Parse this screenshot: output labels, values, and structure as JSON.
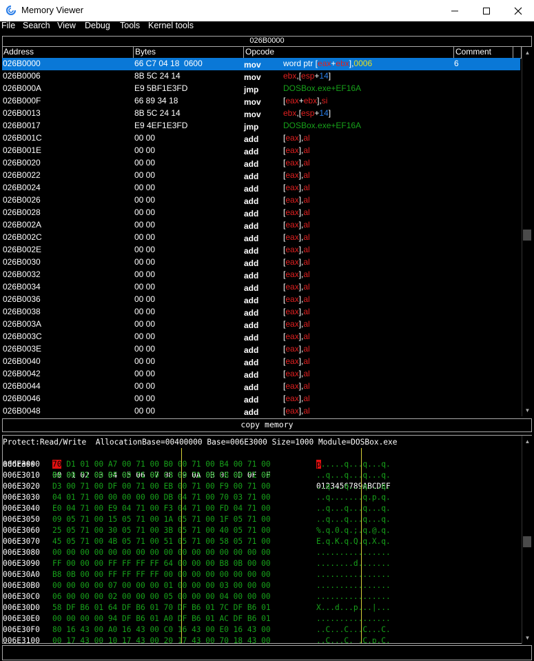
{
  "window": {
    "title": "Memory Viewer",
    "minimize_icon": "minimize-icon",
    "maximize_icon": "maximize-icon",
    "close_icon": "close-icon"
  },
  "menu": [
    "File",
    "Search",
    "View",
    "Debug",
    "Tools",
    "Kernel tools"
  ],
  "disassembler": {
    "header": "026B0000",
    "columns": [
      "Address",
      "Bytes",
      "Opcode",
      "Comment"
    ],
    "rows": [
      {
        "addr": "026B0000",
        "bytes": "66 C7 04 18  0600",
        "op": "mov",
        "args": [
          [
            "word ptr [",
            "w"
          ],
          [
            "eax",
            "r"
          ],
          [
            "+",
            "w"
          ],
          [
            "ebx",
            "r"
          ],
          [
            "],",
            "w"
          ],
          [
            "0006",
            "y"
          ]
        ],
        "comment": "6",
        "selected": true
      },
      {
        "addr": "026B0006",
        "bytes": "8B 5C 24 14",
        "op": "mov",
        "args": [
          [
            "ebx",
            "r"
          ],
          [
            ",[",
            "w"
          ],
          [
            "esp",
            "r"
          ],
          [
            "+",
            "w"
          ],
          [
            "14",
            "b"
          ],
          [
            "]",
            "w"
          ]
        ],
        "comment": ""
      },
      {
        "addr": "026B000A",
        "bytes": "E9 5BF1E3FD",
        "op": "jmp",
        "args": [
          [
            "DOSBox.exe+EF16A",
            "g"
          ]
        ],
        "comment": ""
      },
      {
        "addr": "026B000F",
        "bytes": "66 89 34 18",
        "op": "mov",
        "args": [
          [
            "[",
            "w"
          ],
          [
            "eax",
            "r"
          ],
          [
            "+",
            "w"
          ],
          [
            "ebx",
            "r"
          ],
          [
            "],",
            "w"
          ],
          [
            "si",
            "r"
          ]
        ],
        "comment": ""
      },
      {
        "addr": "026B0013",
        "bytes": "8B 5C 24 14",
        "op": "mov",
        "args": [
          [
            "ebx",
            "r"
          ],
          [
            ",[",
            "w"
          ],
          [
            "esp",
            "r"
          ],
          [
            "+",
            "w"
          ],
          [
            "14",
            "b"
          ],
          [
            "]",
            "w"
          ]
        ],
        "comment": ""
      },
      {
        "addr": "026B0017",
        "bytes": "E9 4EF1E3FD",
        "op": "jmp",
        "args": [
          [
            "DOSBox.exe+EF16A",
            "g"
          ]
        ],
        "comment": ""
      },
      {
        "addr": "026B001C",
        "bytes": "00 00",
        "op": "add",
        "args": [
          [
            "[",
            "w"
          ],
          [
            "eax",
            "r"
          ],
          [
            "],",
            "w"
          ],
          [
            "al",
            "r"
          ]
        ],
        "comment": ""
      },
      {
        "addr": "026B001E",
        "bytes": "00 00",
        "op": "add",
        "args": [
          [
            "[",
            "w"
          ],
          [
            "eax",
            "r"
          ],
          [
            "],",
            "w"
          ],
          [
            "al",
            "r"
          ]
        ],
        "comment": ""
      },
      {
        "addr": "026B0020",
        "bytes": "00 00",
        "op": "add",
        "args": [
          [
            "[",
            "w"
          ],
          [
            "eax",
            "r"
          ],
          [
            "],",
            "w"
          ],
          [
            "al",
            "r"
          ]
        ],
        "comment": ""
      },
      {
        "addr": "026B0022",
        "bytes": "00 00",
        "op": "add",
        "args": [
          [
            "[",
            "w"
          ],
          [
            "eax",
            "r"
          ],
          [
            "],",
            "w"
          ],
          [
            "al",
            "r"
          ]
        ],
        "comment": ""
      },
      {
        "addr": "026B0024",
        "bytes": "00 00",
        "op": "add",
        "args": [
          [
            "[",
            "w"
          ],
          [
            "eax",
            "r"
          ],
          [
            "],",
            "w"
          ],
          [
            "al",
            "r"
          ]
        ],
        "comment": ""
      },
      {
        "addr": "026B0026",
        "bytes": "00 00",
        "op": "add",
        "args": [
          [
            "[",
            "w"
          ],
          [
            "eax",
            "r"
          ],
          [
            "],",
            "w"
          ],
          [
            "al",
            "r"
          ]
        ],
        "comment": ""
      },
      {
        "addr": "026B0028",
        "bytes": "00 00",
        "op": "add",
        "args": [
          [
            "[",
            "w"
          ],
          [
            "eax",
            "r"
          ],
          [
            "],",
            "w"
          ],
          [
            "al",
            "r"
          ]
        ],
        "comment": ""
      },
      {
        "addr": "026B002A",
        "bytes": "00 00",
        "op": "add",
        "args": [
          [
            "[",
            "w"
          ],
          [
            "eax",
            "r"
          ],
          [
            "],",
            "w"
          ],
          [
            "al",
            "r"
          ]
        ],
        "comment": ""
      },
      {
        "addr": "026B002C",
        "bytes": "00 00",
        "op": "add",
        "args": [
          [
            "[",
            "w"
          ],
          [
            "eax",
            "r"
          ],
          [
            "],",
            "w"
          ],
          [
            "al",
            "r"
          ]
        ],
        "comment": ""
      },
      {
        "addr": "026B002E",
        "bytes": "00 00",
        "op": "add",
        "args": [
          [
            "[",
            "w"
          ],
          [
            "eax",
            "r"
          ],
          [
            "],",
            "w"
          ],
          [
            "al",
            "r"
          ]
        ],
        "comment": ""
      },
      {
        "addr": "026B0030",
        "bytes": "00 00",
        "op": "add",
        "args": [
          [
            "[",
            "w"
          ],
          [
            "eax",
            "r"
          ],
          [
            "],",
            "w"
          ],
          [
            "al",
            "r"
          ]
        ],
        "comment": ""
      },
      {
        "addr": "026B0032",
        "bytes": "00 00",
        "op": "add",
        "args": [
          [
            "[",
            "w"
          ],
          [
            "eax",
            "r"
          ],
          [
            "],",
            "w"
          ],
          [
            "al",
            "r"
          ]
        ],
        "comment": ""
      },
      {
        "addr": "026B0034",
        "bytes": "00 00",
        "op": "add",
        "args": [
          [
            "[",
            "w"
          ],
          [
            "eax",
            "r"
          ],
          [
            "],",
            "w"
          ],
          [
            "al",
            "r"
          ]
        ],
        "comment": ""
      },
      {
        "addr": "026B0036",
        "bytes": "00 00",
        "op": "add",
        "args": [
          [
            "[",
            "w"
          ],
          [
            "eax",
            "r"
          ],
          [
            "],",
            "w"
          ],
          [
            "al",
            "r"
          ]
        ],
        "comment": ""
      },
      {
        "addr": "026B0038",
        "bytes": "00 00",
        "op": "add",
        "args": [
          [
            "[",
            "w"
          ],
          [
            "eax",
            "r"
          ],
          [
            "],",
            "w"
          ],
          [
            "al",
            "r"
          ]
        ],
        "comment": ""
      },
      {
        "addr": "026B003A",
        "bytes": "00 00",
        "op": "add",
        "args": [
          [
            "[",
            "w"
          ],
          [
            "eax",
            "r"
          ],
          [
            "],",
            "w"
          ],
          [
            "al",
            "r"
          ]
        ],
        "comment": ""
      },
      {
        "addr": "026B003C",
        "bytes": "00 00",
        "op": "add",
        "args": [
          [
            "[",
            "w"
          ],
          [
            "eax",
            "r"
          ],
          [
            "],",
            "w"
          ],
          [
            "al",
            "r"
          ]
        ],
        "comment": ""
      },
      {
        "addr": "026B003E",
        "bytes": "00 00",
        "op": "add",
        "args": [
          [
            "[",
            "w"
          ],
          [
            "eax",
            "r"
          ],
          [
            "],",
            "w"
          ],
          [
            "al",
            "r"
          ]
        ],
        "comment": ""
      },
      {
        "addr": "026B0040",
        "bytes": "00 00",
        "op": "add",
        "args": [
          [
            "[",
            "w"
          ],
          [
            "eax",
            "r"
          ],
          [
            "],",
            "w"
          ],
          [
            "al",
            "r"
          ]
        ],
        "comment": ""
      },
      {
        "addr": "026B0042",
        "bytes": "00 00",
        "op": "add",
        "args": [
          [
            "[",
            "w"
          ],
          [
            "eax",
            "r"
          ],
          [
            "],",
            "w"
          ],
          [
            "al",
            "r"
          ]
        ],
        "comment": ""
      },
      {
        "addr": "026B0044",
        "bytes": "00 00",
        "op": "add",
        "args": [
          [
            "[",
            "w"
          ],
          [
            "eax",
            "r"
          ],
          [
            "],",
            "w"
          ],
          [
            "al",
            "r"
          ]
        ],
        "comment": ""
      },
      {
        "addr": "026B0046",
        "bytes": "00 00",
        "op": "add",
        "args": [
          [
            "[",
            "w"
          ],
          [
            "eax",
            "r"
          ],
          [
            "],",
            "w"
          ],
          [
            "al",
            "r"
          ]
        ],
        "comment": ""
      },
      {
        "addr": "026B0048",
        "bytes": "00 00",
        "op": "add",
        "args": [
          [
            "[",
            "w"
          ],
          [
            "eax",
            "r"
          ],
          [
            "],",
            "w"
          ],
          [
            "al",
            "r"
          ]
        ],
        "comment": ""
      }
    ]
  },
  "copy_button": "copy memory",
  "hexview": {
    "info": "Protect:Read/Write  AllocationBase=00400000 Base=006E3000 Size=1000 Module=DOSBox.exe",
    "header_addr": "address",
    "header_bytes": "00 01 02 03 04 05 06 07 08 09 0A 0B 0C 0D 0E 0F",
    "header_ascii": "0123456789ABCDEF",
    "rows": [
      {
        "addr": "006E3000",
        "bytes": "70 D1 01 00 A7 00 71 00 B0 00 71 00 B4 00 71 00",
        "ascii": "p.....q...q...q."
      },
      {
        "addr": "006E3010",
        "bytes": "BA 00 71 00 BF 00 71 00 C3 00 71 00 CB 00 71 00",
        "ascii": "..q...q...q...q."
      },
      {
        "addr": "006E3020",
        "bytes": "D3 00 71 00 DF 00 71 00 EB 00 71 00 F9 00 71 00",
        "ascii": "..q...q...q...q."
      },
      {
        "addr": "006E3030",
        "bytes": "04 01 71 00 00 00 00 00 DB 04 71 00 70 03 71 00",
        "ascii": "..q.......q.p.q."
      },
      {
        "addr": "006E3040",
        "bytes": "E0 04 71 00 E9 04 71 00 F3 04 71 00 FD 04 71 00",
        "ascii": "..q...q...q...q."
      },
      {
        "addr": "006E3050",
        "bytes": "09 05 71 00 15 05 71 00 1A 05 71 00 1F 05 71 00",
        "ascii": "..q...q...q...q."
      },
      {
        "addr": "006E3060",
        "bytes": "25 05 71 00 30 05 71 00 3B 05 71 00 40 05 71 00",
        "ascii": "%.q.0.q.;.q.@.q."
      },
      {
        "addr": "006E3070",
        "bytes": "45 05 71 00 4B 05 71 00 51 05 71 00 58 05 71 00",
        "ascii": "E.q.K.q.Q.q.X.q."
      },
      {
        "addr": "006E3080",
        "bytes": "00 00 00 00 00 00 00 00 00 00 00 00 00 00 00 00",
        "ascii": "................"
      },
      {
        "addr": "006E3090",
        "bytes": "FF 00 00 00 FF FF FF FF 64 00 00 00 B8 0B 00 00",
        "ascii": "........d......."
      },
      {
        "addr": "006E30A0",
        "bytes": "B8 0B 00 00 FF FF FF FF 00 00 00 00 00 00 00 00",
        "ascii": "................"
      },
      {
        "addr": "006E30B0",
        "bytes": "00 00 00 00 07 00 00 00 01 00 00 00 03 00 00 00",
        "ascii": "................"
      },
      {
        "addr": "006E30C0",
        "bytes": "06 00 00 00 02 00 00 00 05 00 00 00 04 00 00 00",
        "ascii": "................"
      },
      {
        "addr": "006E30D0",
        "bytes": "58 DF B6 01 64 DF B6 01 70 DF B6 01 7C DF B6 01",
        "ascii": "X...d...p...|..."
      },
      {
        "addr": "006E30E0",
        "bytes": "00 00 00 00 94 DF B6 01 A0 DF B6 01 AC DF B6 01",
        "ascii": "................"
      },
      {
        "addr": "006E30F0",
        "bytes": "80 16 43 00 A0 16 43 00 C0 16 43 00 E0 16 43 00",
        "ascii": "..C...C...C...C."
      },
      {
        "addr": "006E3100",
        "bytes": "00 17 43 00 10 17 43 00 20 17 43 00 70 18 43 00",
        "ascii": "..C...C. .C.p.C."
      }
    ]
  },
  "colors": {
    "selection": "#0a78d7",
    "register": "#e02020",
    "immediate": "#2a7ee8",
    "symbol": "#17a21a",
    "constant": "#e8e020",
    "hex_bytes": "#17a21a",
    "highlight": "#e01010"
  }
}
